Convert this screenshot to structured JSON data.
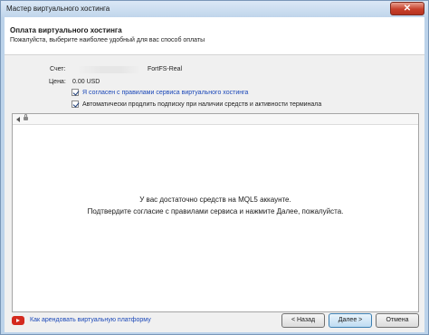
{
  "window": {
    "title": "Мастер виртуального хостинга",
    "close_label": "✕"
  },
  "header": {
    "title": "Оплата виртуального хостинга",
    "subtitle": "Пожалуйста, выберите наиболее удобный для вас способ оплаты"
  },
  "form": {
    "account_label": "Счет:",
    "account_value": "FortFS-Real",
    "price_label": "Цена:",
    "price_value": "0.00 USD",
    "agree_terms": {
      "label": "Я согласен с правилами сервиса виртуального хостинга",
      "checked": true
    },
    "auto_renew": {
      "label": "Автоматически продлить подписку при наличии средств и активности терминала",
      "checked": true
    }
  },
  "browser": {
    "message_line1": "У вас достаточно средств на MQL5 аккаунте.",
    "message_line2": "Подтвердите согласие с правилами сервиса и нажмите Далее, пожалуйста."
  },
  "footer": {
    "link_label": "Как арендовать виртуальную платформу",
    "back_label": "< Назад",
    "next_label": "Далее >",
    "cancel_label": "Отмена"
  },
  "colors": {
    "link": "#1a47b8",
    "youtube_red": "#d42a1e",
    "title_bar": "#c0d5eb"
  }
}
